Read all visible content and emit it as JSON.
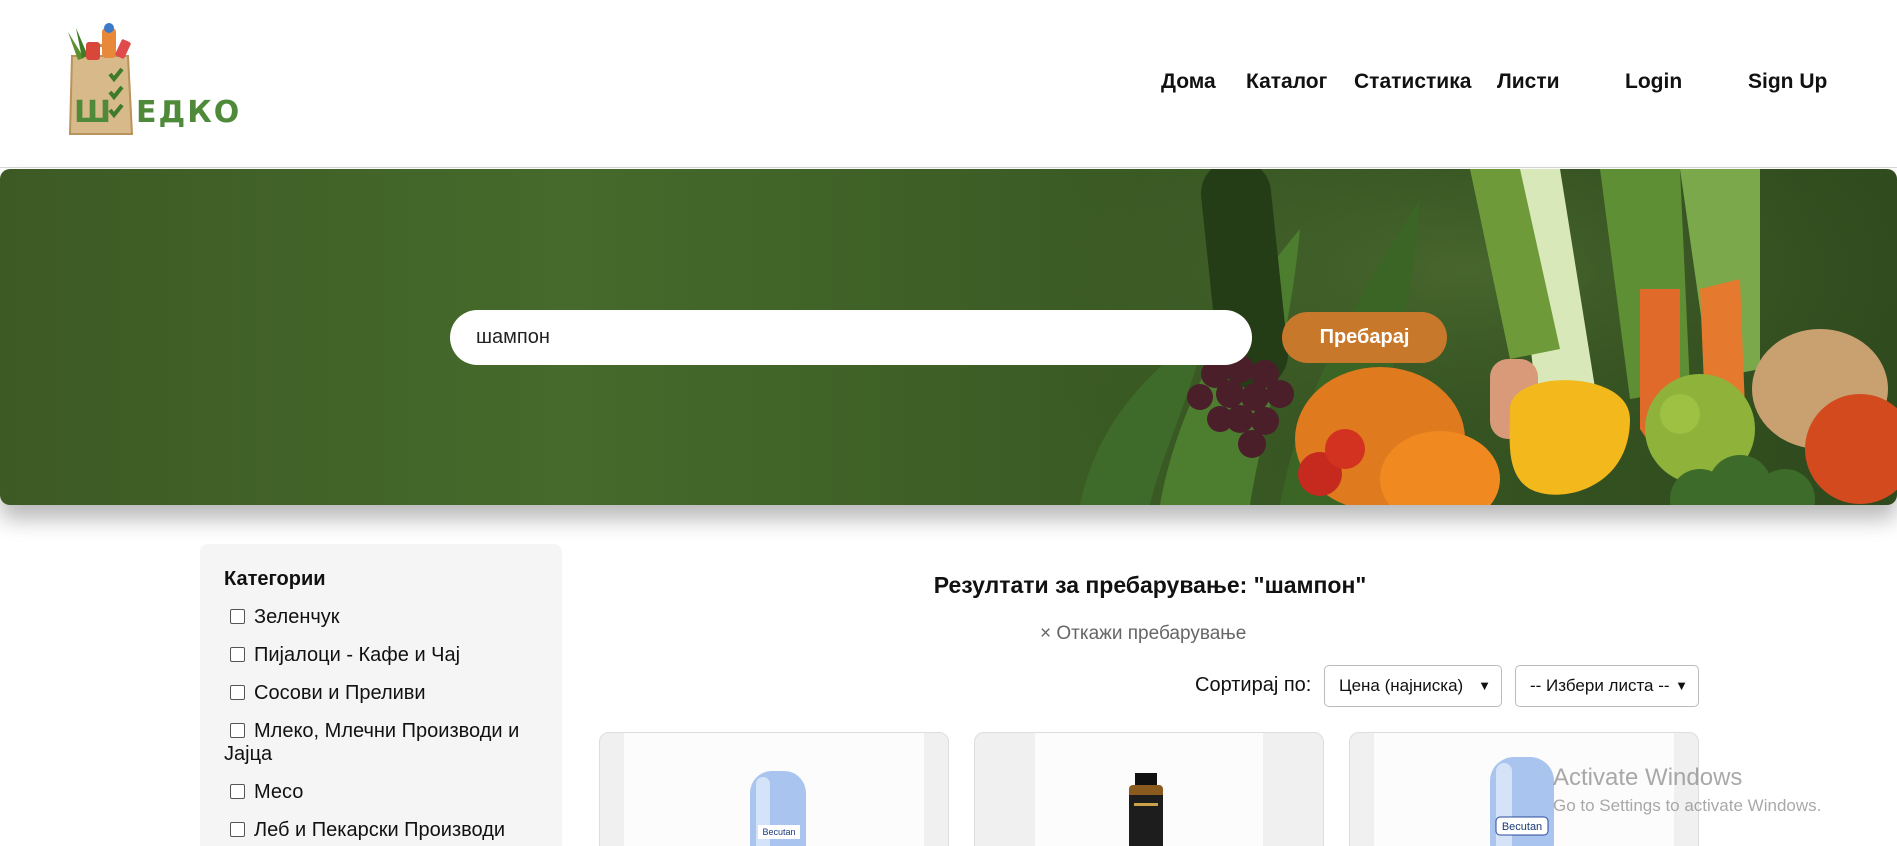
{
  "header": {
    "logo_text": "ШЕДКО",
    "nav": {
      "home": "Дома",
      "catalog": "Каталог",
      "statistics": "Статистика",
      "lists": "Листи",
      "login": "Login",
      "signup": "Sign Up"
    }
  },
  "hero": {
    "search_value": "шампон",
    "search_button": "Пребарај"
  },
  "sidebar": {
    "title": "Категории",
    "categories": [
      "Зеленчук",
      "Пијалоци - Кафе и Чај",
      "Сосови и Преливи",
      "Млеко, Млечни Производи и Јајца",
      "Месо",
      "Леб и Пекарски Производи"
    ]
  },
  "results": {
    "title": "Резултати за пребарување: \"шампон\"",
    "cancel": "× Откажи пребарување",
    "sort_label": "Сортирај по:",
    "sort_selected": "Цена (најниска)",
    "list_selected": "-- Избери листа --"
  },
  "products": [
    {
      "brand": "Becutan",
      "icon": "shampoo-bottle-blue"
    },
    {
      "brand": "",
      "icon": "shampoo-bottle-dark"
    },
    {
      "brand": "Becutan",
      "icon": "shampoo-bottle-blue"
    }
  ],
  "watermark": {
    "line1": "Activate Windows",
    "line2": "Go to Settings to activate Windows."
  },
  "colors": {
    "brand_green": "#4f8a3a",
    "search_button": "#c8782a",
    "hero_bg": "#3d5a25"
  }
}
